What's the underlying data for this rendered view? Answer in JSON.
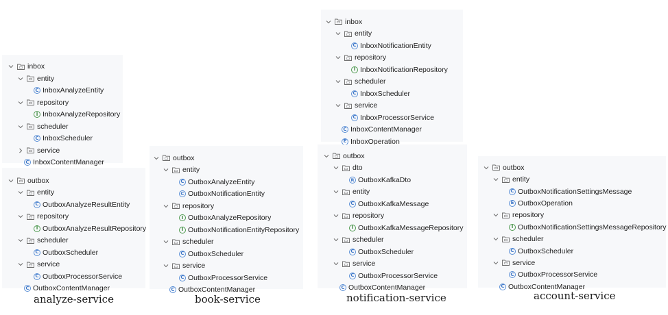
{
  "captions": [
    "analyze-service",
    "book-service",
    "notification-service",
    "account-service"
  ],
  "trees": {
    "analyze_inbox": [
      {
        "kind": "folder",
        "open": true,
        "label": "inbox"
      },
      {
        "kind": "folder",
        "open": true,
        "label": "entity"
      },
      {
        "kind": "class",
        "label": "InboxAnalyzeEntity"
      },
      {
        "kind": "folder",
        "open": true,
        "label": "repository"
      },
      {
        "kind": "interface",
        "label": "InboxAnalyzeRepository"
      },
      {
        "kind": "folder",
        "open": true,
        "label": "scheduler"
      },
      {
        "kind": "class",
        "label": "InboxScheduler"
      },
      {
        "kind": "folder",
        "open": false,
        "label": "service"
      },
      {
        "kind": "class",
        "label": "InboxContentManager"
      }
    ],
    "analyze_outbox": [
      {
        "kind": "folder",
        "open": true,
        "label": "outbox"
      },
      {
        "kind": "folder",
        "open": true,
        "label": "entity"
      },
      {
        "kind": "class",
        "label": "OutboxAnalyzeResultEntity"
      },
      {
        "kind": "folder",
        "open": true,
        "label": "repository"
      },
      {
        "kind": "interface",
        "label": "OutboxAnalyzeResultRepository"
      },
      {
        "kind": "folder",
        "open": true,
        "label": "scheduler"
      },
      {
        "kind": "class",
        "label": "OutboxScheduler"
      },
      {
        "kind": "folder",
        "open": true,
        "label": "service"
      },
      {
        "kind": "class",
        "label": "OutboxProcessorService"
      },
      {
        "kind": "class",
        "label": "OutboxContentManager"
      }
    ],
    "book_outbox": [
      {
        "kind": "folder",
        "open": true,
        "label": "outbox"
      },
      {
        "kind": "folder",
        "open": true,
        "label": "entity"
      },
      {
        "kind": "class",
        "label": "OutboxAnalyzeEntity"
      },
      {
        "kind": "class",
        "label": "OutboxNotificationEntity"
      },
      {
        "kind": "folder",
        "open": true,
        "label": "repository"
      },
      {
        "kind": "interface",
        "label": "OutboxAnalyzeRepository"
      },
      {
        "kind": "interface",
        "label": "OutboxNotificationEntityRepository"
      },
      {
        "kind": "folder",
        "open": true,
        "label": "scheduler"
      },
      {
        "kind": "class",
        "label": "OutboxScheduler"
      },
      {
        "kind": "folder",
        "open": true,
        "label": "service"
      },
      {
        "kind": "class",
        "label": "OutboxProcessorService"
      },
      {
        "kind": "class",
        "label": "OutboxContentManager"
      }
    ],
    "notification_inbox": [
      {
        "kind": "folder",
        "open": true,
        "label": "inbox"
      },
      {
        "kind": "folder",
        "open": true,
        "label": "entity"
      },
      {
        "kind": "class",
        "label": "InboxNotificationEntity"
      },
      {
        "kind": "folder",
        "open": true,
        "label": "repository"
      },
      {
        "kind": "interface",
        "label": "InboxNotificationRepository"
      },
      {
        "kind": "folder",
        "open": true,
        "label": "scheduler"
      },
      {
        "kind": "class",
        "label": "InboxScheduler"
      },
      {
        "kind": "folder",
        "open": true,
        "label": "service"
      },
      {
        "kind": "class",
        "label": "InboxProcessorService"
      },
      {
        "kind": "class",
        "label": "InboxContentManager"
      },
      {
        "kind": "enum",
        "label": "InboxOperation"
      }
    ],
    "notification_outbox": [
      {
        "kind": "folder",
        "open": true,
        "label": "outbox"
      },
      {
        "kind": "folder",
        "open": true,
        "label": "dto"
      },
      {
        "kind": "record",
        "label": "OutboxKafkaDto"
      },
      {
        "kind": "folder",
        "open": true,
        "label": "entity"
      },
      {
        "kind": "class",
        "label": "OutboxKafkaMessage"
      },
      {
        "kind": "folder",
        "open": true,
        "label": "repository"
      },
      {
        "kind": "interface",
        "label": "OutboxKafkaMessageRepository"
      },
      {
        "kind": "folder",
        "open": true,
        "label": "scheduler"
      },
      {
        "kind": "class",
        "label": "OutboxScheduler"
      },
      {
        "kind": "folder",
        "open": true,
        "label": "service"
      },
      {
        "kind": "class",
        "label": "OutboxProcessorService"
      },
      {
        "kind": "class",
        "label": "OutboxContentManager"
      }
    ],
    "account_outbox": [
      {
        "kind": "folder",
        "open": true,
        "label": "outbox"
      },
      {
        "kind": "folder",
        "open": true,
        "label": "entity"
      },
      {
        "kind": "class",
        "label": "OutboxNotificationSettingsMessage"
      },
      {
        "kind": "enum",
        "label": "OutboxOperation"
      },
      {
        "kind": "folder",
        "open": true,
        "label": "repository"
      },
      {
        "kind": "interface",
        "label": "OutboxNotificationSettingsMessageRepository"
      },
      {
        "kind": "folder",
        "open": true,
        "label": "scheduler"
      },
      {
        "kind": "class",
        "label": "OutboxScheduler"
      },
      {
        "kind": "folder",
        "open": true,
        "label": "service"
      },
      {
        "kind": "class",
        "label": "OutboxProcessorService"
      },
      {
        "kind": "class",
        "label": "OutboxContentManager"
      }
    ]
  },
  "icon_letters": {
    "class": "C",
    "interface": "I",
    "enum": "E",
    "record": "R"
  }
}
